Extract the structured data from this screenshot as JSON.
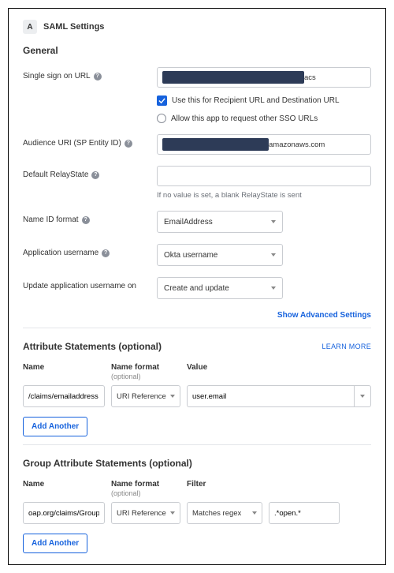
{
  "header": {
    "step_badge": "A",
    "title": "SAML Settings"
  },
  "general": {
    "heading": "General",
    "sso_url": {
      "label": "Single sign on URL",
      "suffix": "acs",
      "check1_label": "Use this for Recipient URL and Destination URL",
      "check2_label": "Allow this app to request other SSO URLs"
    },
    "audience_uri": {
      "label": "Audience URI (SP Entity ID)",
      "suffix": "amazonaws.com"
    },
    "relay_state": {
      "label": "Default RelayState",
      "value": "",
      "helper": "If no value is set, a blank RelayState is sent"
    },
    "name_id": {
      "label": "Name ID format",
      "value": "EmailAddress"
    },
    "app_username": {
      "label": "Application username",
      "value": "Okta username"
    },
    "update_username": {
      "label": "Update application username on",
      "value": "Create and update"
    },
    "advanced_link": "Show Advanced Settings"
  },
  "attr": {
    "heading": "Attribute Statements (optional)",
    "learn_more": "LEARN MORE",
    "cols": {
      "name": "Name",
      "format": "Name format",
      "format_sub": "(optional)",
      "value": "Value"
    },
    "row": {
      "name": "/claims/emailaddress",
      "format": "URI Reference",
      "value": "user.email"
    },
    "add_another": "Add Another"
  },
  "group_attr": {
    "heading": "Group Attribute Statements (optional)",
    "cols": {
      "name": "Name",
      "format": "Name format",
      "format_sub": "(optional)",
      "filter": "Filter"
    },
    "row": {
      "name": "oap.org/claims/Group",
      "format": "URI Reference",
      "filter_type": "Matches regex",
      "filter_value": ".*open.*"
    },
    "add_another": "Add Another"
  }
}
